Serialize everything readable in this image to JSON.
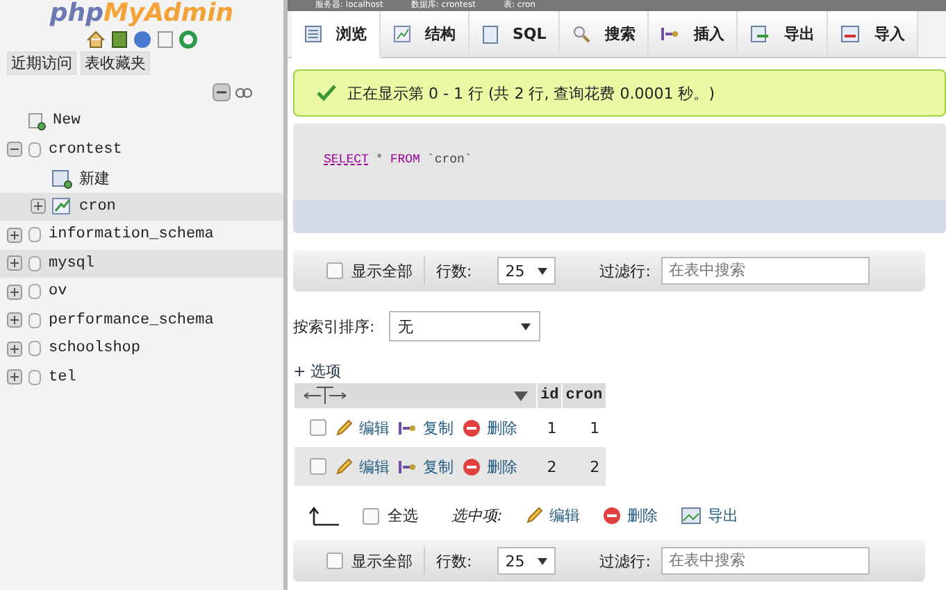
{
  "logo": {
    "prefix": "php",
    "name": "MyAdmin"
  },
  "sidebar_tabs": [
    "近期访问",
    "表收藏夹"
  ],
  "tree": [
    {
      "label": "New",
      "kind": "new",
      "selected": false
    },
    {
      "label": "crontest",
      "kind": "database",
      "expanded": true,
      "selected": false,
      "children": [
        {
          "label": "新建",
          "kind": "new",
          "selected": false
        },
        {
          "label": "cron",
          "kind": "table",
          "expanded": false,
          "selected": true
        }
      ]
    },
    {
      "label": "information_schema",
      "kind": "database",
      "expanded": false,
      "selected": false
    },
    {
      "label": "mysql",
      "kind": "database",
      "expanded": false,
      "selected": true
    },
    {
      "label": "ov",
      "kind": "database",
      "expanded": false,
      "selected": false
    },
    {
      "label": "performance_schema",
      "kind": "database",
      "expanded": false,
      "selected": false
    },
    {
      "label": "schoolshop",
      "kind": "database",
      "expanded": false,
      "selected": false
    },
    {
      "label": "tel",
      "kind": "database",
      "expanded": false,
      "selected": false
    }
  ],
  "breadcrumb": [
    "服务器: localhost",
    "数据库: crontest",
    "表: cron"
  ],
  "tabs": [
    {
      "label": "浏览",
      "kind": "browse",
      "selected": true
    },
    {
      "label": "结构",
      "kind": "structure",
      "selected": false
    },
    {
      "label": "SQL",
      "kind": "sql",
      "selected": false
    },
    {
      "label": "搜索",
      "kind": "search",
      "selected": false
    },
    {
      "label": "插入",
      "kind": "insert",
      "selected": false
    },
    {
      "label": "导出",
      "kind": "export",
      "selected": false
    },
    {
      "label": "导入",
      "kind": "import",
      "selected": false
    }
  ],
  "message": "正在显示第 0 - 1 行 (共 2 行, 查询花费 0.0001 秒。)",
  "sql": [
    {
      "kind": "keyword",
      "text": "SELECT"
    },
    {
      "kind": "operator",
      "text": "*"
    },
    {
      "kind": "keyword",
      "text": "FROM"
    },
    {
      "kind": "name",
      "text": "`cron`"
    }
  ],
  "nav_bars": [
    {
      "show_all": {
        "label": "显示全部",
        "checked": false
      },
      "rows_label": "行数:",
      "rows_value": "25",
      "filter_label": "过滤行:",
      "filter_placeholder": "在表中搜索"
    },
    {
      "show_all": {
        "label": "显示全部",
        "checked": false
      },
      "rows_label": "行数:",
      "rows_value": "25",
      "filter_label": "过滤行:",
      "filter_placeholder": "在表中搜索"
    }
  ],
  "sort": {
    "label": "按索引排序:",
    "value": "无"
  },
  "options_link": "+ 选项",
  "table": {
    "columns": [
      "id",
      "cron"
    ],
    "rows": [
      {
        "checked": false,
        "actions": [
          {
            "kind": "edit",
            "label": "编辑"
          },
          {
            "kind": "copy",
            "label": "复制"
          },
          {
            "kind": "delete",
            "label": "删除"
          }
        ],
        "cells": [
          "1",
          "1"
        ]
      },
      {
        "checked": false,
        "actions": [
          {
            "kind": "edit",
            "label": "编辑"
          },
          {
            "kind": "copy",
            "label": "复制"
          },
          {
            "kind": "delete",
            "label": "删除"
          }
        ],
        "cells": [
          "2",
          "2"
        ]
      }
    ]
  },
  "bulk": {
    "select_all": {
      "label": "全选",
      "checked": false
    },
    "with_selected": "选中项:",
    "actions": [
      {
        "kind": "edit",
        "label": "编辑"
      },
      {
        "kind": "delete",
        "label": "删除"
      },
      {
        "kind": "export",
        "label": "导出"
      }
    ]
  }
}
